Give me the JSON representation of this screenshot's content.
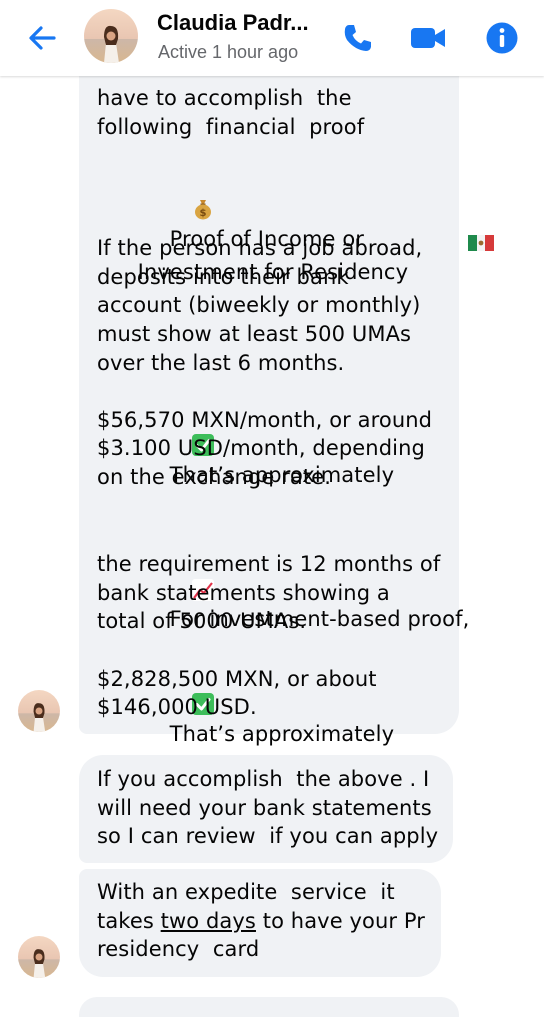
{
  "header": {
    "contact_name": "Claudia Padr...",
    "status": "Active 1 hour ago",
    "icons": [
      "back-arrow-icon",
      "phone-icon",
      "video-camera-icon",
      "info-icon"
    ]
  },
  "colors": {
    "accent": "#1877f2",
    "bubble_bg": "#f0f2f5",
    "text": "#050505",
    "secondary_text": "#65676b",
    "check_green": "#3dbd5a"
  },
  "messages": {
    "m1": {
      "lines": [
        "have to accomplish  the",
        "following  financial  proof",
        "Proof of Income or",
        "Investment for Residency",
        "If the person has a job abroad,",
        "deposits into their bank",
        "account (biweekly or monthly)",
        "must show at least 500 UMAs",
        "over the last 6 months.",
        "That’s approximately",
        "$56,570 MXN/month, or around",
        "$3.100 USD/month, depending",
        "on the exchange rate.",
        "For investment-based proof,",
        "the requirement is 12 months of",
        "bank statements showing a",
        "total of 5000 UMAs.",
        "That’s approximately",
        "$2,828,500 MXN, or about",
        "$146,000 USD."
      ]
    },
    "m2": {
      "lines": [
        "If you accomplish  the above . I",
        "will need your bank statements",
        "so I can review  if you can apply"
      ]
    },
    "m3": {
      "line1": "With an expedite  service  it",
      "line2_before": "takes ",
      "line2_underlined": "two days",
      "line2_after": " to have your Pr",
      "line3": "residency  card"
    }
  }
}
